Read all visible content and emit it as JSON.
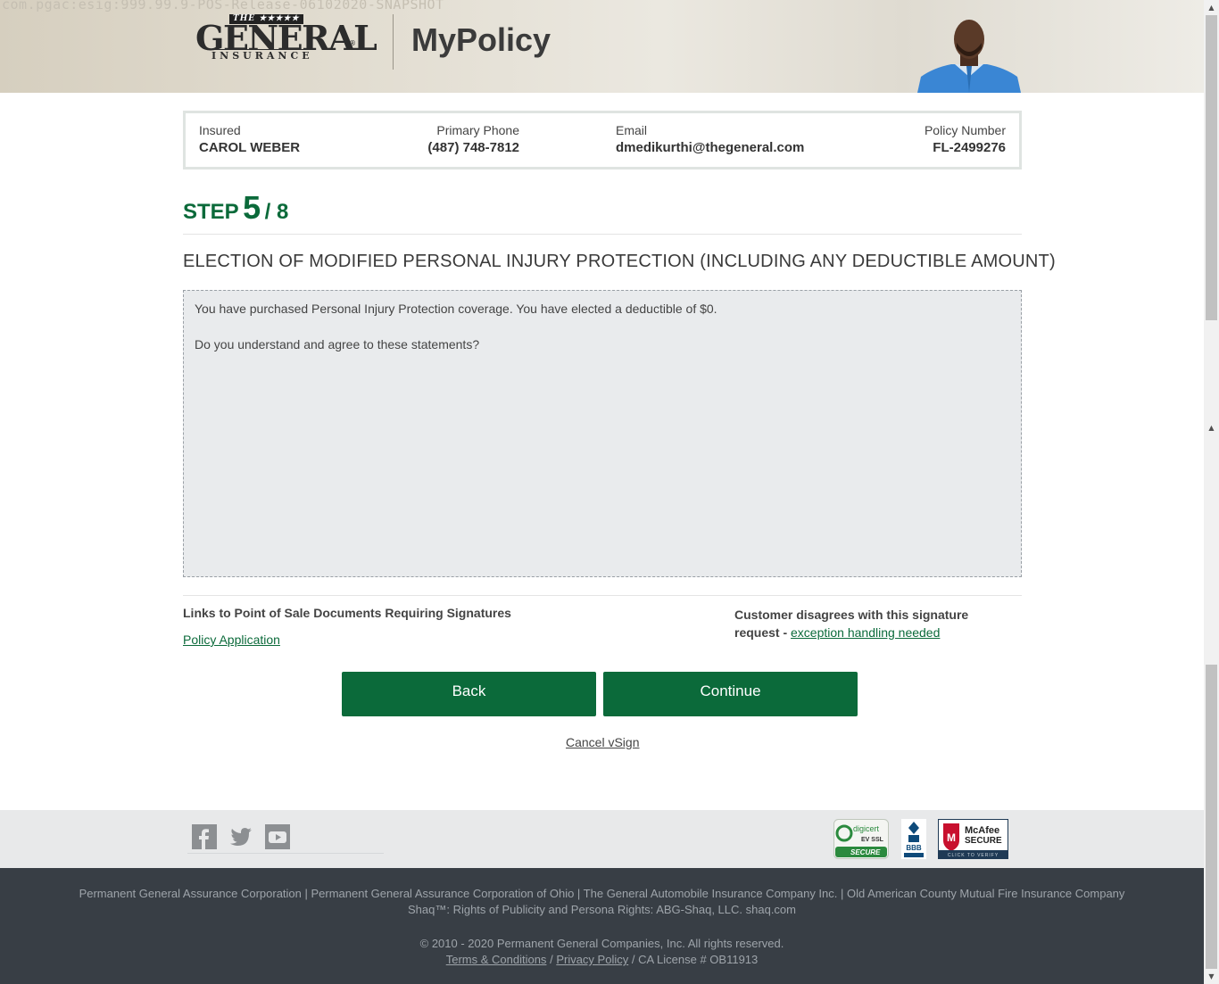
{
  "header": {
    "snapshot_text": "com.pgac:esig:999.99.9-POS-Release-06102020-SNAPSHOT",
    "logo": {
      "the": "THE ★★★★★",
      "name": "GENERAL",
      "tagline": "INSURANCE",
      "reg": "®"
    },
    "app_title": "MyPolicy"
  },
  "insured_info": {
    "insured_label": "Insured",
    "insured_value": "CAROL WEBER",
    "phone_label": "Primary Phone",
    "phone_value": "(487) 748-7812",
    "email_label": "Email",
    "email_value": "dmedikurthi@thegeneral.com",
    "policy_label": "Policy Number",
    "policy_value": "FL-2499276"
  },
  "step": {
    "word": "STEP",
    "current": "5",
    "total": "/ 8"
  },
  "section_title": "ELECTION OF MODIFIED PERSONAL INJURY PROTECTION (INCLUDING ANY DEDUCTIBLE AMOUNT)",
  "statement": {
    "line1": "You have purchased Personal Injury Protection coverage. You have elected a deductible of $0.",
    "line2": "Do you understand and agree to these statements?"
  },
  "links": {
    "title": "Links to Point of Sale Documents Requiring Signatures",
    "policy_application": "Policy Application",
    "disagree_text": "Customer disagrees with this signature request -",
    "exception_link": "exception handling needed"
  },
  "buttons": {
    "back": "Back",
    "continue": "Continue",
    "cancel": "Cancel vSign"
  },
  "footer": {
    "badges": {
      "digicert_top": "digicert",
      "digicert_mid": "EV SSL",
      "digicert_bottom": "SECURE",
      "bbb": "BBB",
      "mcafee_name": "McAfee",
      "mcafee_secure": "SECURE",
      "mcafee_verify": "CLICK TO VERIFY"
    },
    "companies": "Permanent General Assurance Corporation | Permanent General Assurance Corporation of Ohio | The General Automobile Insurance Company Inc. | Old American County Mutual Fire Insurance Company",
    "shaq": "Shaq™: Rights of Publicity and Persona Rights: ABG-Shaq, LLC. shaq.com",
    "copyright": "© 2010 - 2020 Permanent General Companies, Inc. All rights reserved.",
    "terms": "Terms & Conditions",
    "sep1": "/",
    "privacy": "Privacy Policy",
    "license": "/ CA License # OB11913"
  },
  "colors": {
    "brand_green": "#0b6a3a",
    "footer_dark": "#383e45",
    "social_bg": "#e8e9ea"
  },
  "icons": [
    "facebook-icon",
    "twitter-icon",
    "youtube-icon",
    "digicert-badge",
    "bbb-badge",
    "mcafee-badge"
  ]
}
